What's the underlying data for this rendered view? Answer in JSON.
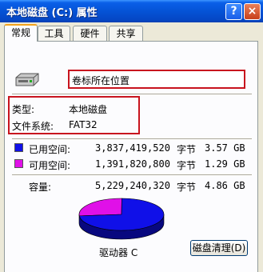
{
  "window": {
    "title": "本地磁盘 (C:) 属性",
    "help_button": "?",
    "close_button": "×"
  },
  "tabs": [
    "常规",
    "工具",
    "硬件",
    "共享"
  ],
  "general": {
    "volume_label": "卷标所在位置",
    "type_label": "类型:",
    "type_value": "本地磁盘",
    "fs_label": "文件系统:",
    "fs_value": "FAT32",
    "used": {
      "label": "已用空间:",
      "bytes": "3,837,419,520",
      "unit": "字节",
      "size": "3.57 GB",
      "color": "#1010e8"
    },
    "free": {
      "label": "可用空间:",
      "bytes": "1,391,820,800",
      "unit": "字节",
      "size": "1.29 GB",
      "color": "#e010e8"
    },
    "capacity": {
      "label": "容量:",
      "bytes": "5,229,240,320",
      "unit": "字节",
      "size": "4.86 GB"
    },
    "drive_label": "驱动器 C",
    "cleanup_button": "磁盘清理(D)"
  },
  "chart_data": {
    "type": "pie",
    "labels": [
      "已用空间",
      "可用空间"
    ],
    "values": [
      3837419520,
      1391820800
    ],
    "colors": [
      "#1010e8",
      "#e010e8"
    ]
  }
}
